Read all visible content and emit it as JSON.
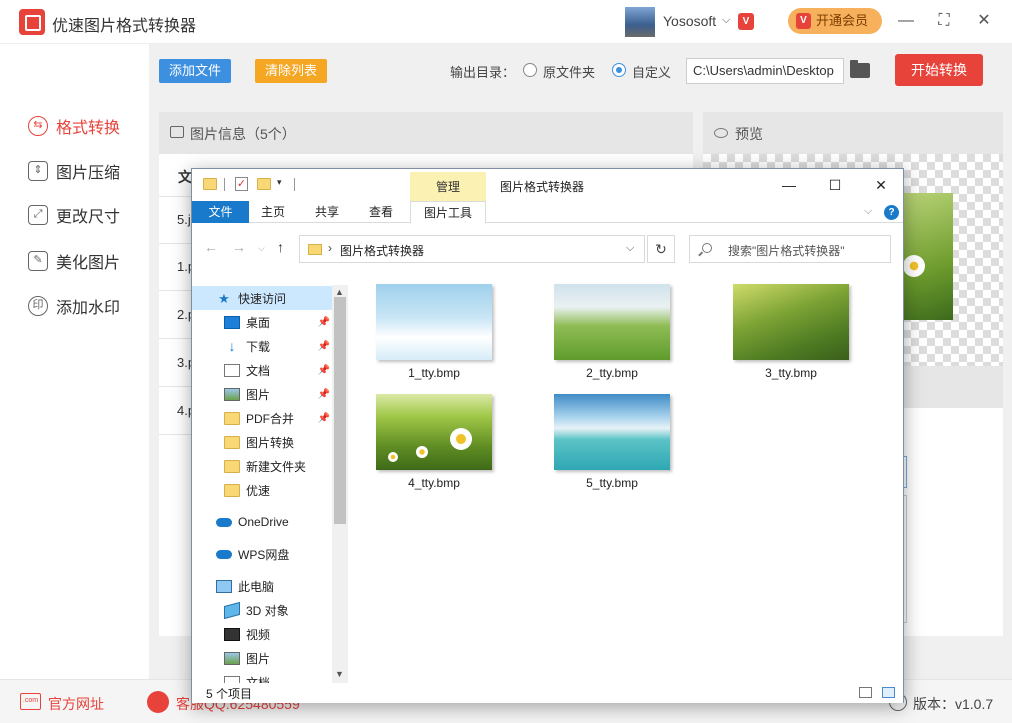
{
  "app": {
    "title": "优速图片格式转换器",
    "user": "Yososoft",
    "vip_button": "开通会员",
    "vip_mark": "V"
  },
  "sidebar": {
    "items": [
      {
        "label": "格式转换",
        "icon": "format-convert-icon",
        "active": true
      },
      {
        "label": "图片压缩",
        "icon": "compress-icon",
        "active": false
      },
      {
        "label": "更改尺寸",
        "icon": "resize-icon",
        "active": false
      },
      {
        "label": "美化图片",
        "icon": "beautify-icon",
        "active": false
      },
      {
        "label": "添加水印",
        "icon": "watermark-icon",
        "active": false
      }
    ]
  },
  "toolbar": {
    "add_file": "添加文件",
    "clear_list": "清除列表",
    "output_label": "输出目录：",
    "radio_original": "原文件夹",
    "radio_custom": "自定义",
    "radio_selected": "custom",
    "path_value": "C:\\Users\\admin\\Desktop",
    "start": "开始转换"
  },
  "image_info": {
    "title": "图片信息（5个）",
    "column_head": "文",
    "rows": [
      "5.j",
      "1.p",
      "2.p",
      "3.p",
      "4.p"
    ]
  },
  "preview": {
    "title": "预览"
  },
  "footer": {
    "website": "官方网址",
    "website_icon_text": ".com",
    "support": "客服QQ:625480559",
    "version": "版本：v1.0.7"
  },
  "explorer": {
    "manage_tab": "管理",
    "window_title": "图片格式转换器",
    "ribbon_tabs": [
      "文件",
      "主页",
      "共享",
      "查看",
      "图片工具"
    ],
    "address": "图片格式转换器",
    "search_placeholder": "搜索\"图片格式转换器\"",
    "nav_items": [
      {
        "label": "快速访问",
        "icon": "star-icon",
        "pinned": false,
        "selected": true,
        "indent": 0
      },
      {
        "label": "桌面",
        "icon": "desktop-icon",
        "pinned": true,
        "selected": false,
        "indent": 1
      },
      {
        "label": "下载",
        "icon": "download-icon",
        "pinned": true,
        "selected": false,
        "indent": 1
      },
      {
        "label": "文档",
        "icon": "document-icon",
        "pinned": true,
        "selected": false,
        "indent": 1
      },
      {
        "label": "图片",
        "icon": "pictures-icon",
        "pinned": true,
        "selected": false,
        "indent": 1
      },
      {
        "label": "PDF合并",
        "icon": "folder-icon",
        "pinned": true,
        "selected": false,
        "indent": 1
      },
      {
        "label": "图片转换",
        "icon": "folder-icon",
        "pinned": false,
        "selected": false,
        "indent": 1
      },
      {
        "label": "新建文件夹",
        "icon": "folder-icon",
        "pinned": false,
        "selected": false,
        "indent": 1
      },
      {
        "label": "优速",
        "icon": "folder-icon",
        "pinned": false,
        "selected": false,
        "indent": 1
      },
      {
        "label": "OneDrive",
        "icon": "onedrive-icon",
        "pinned": false,
        "selected": false,
        "indent": 0
      },
      {
        "label": "WPS网盘",
        "icon": "wps-cloud-icon",
        "pinned": false,
        "selected": false,
        "indent": 0
      },
      {
        "label": "此电脑",
        "icon": "computer-icon",
        "pinned": false,
        "selected": false,
        "indent": 0
      },
      {
        "label": "3D 对象",
        "icon": "3d-objects-icon",
        "pinned": false,
        "selected": false,
        "indent": 1
      },
      {
        "label": "视频",
        "icon": "video-icon",
        "pinned": false,
        "selected": false,
        "indent": 1
      },
      {
        "label": "图片",
        "icon": "pictures-icon",
        "pinned": false,
        "selected": false,
        "indent": 1
      },
      {
        "label": "文档",
        "icon": "document-icon",
        "pinned": false,
        "selected": false,
        "indent": 1
      }
    ],
    "files": [
      {
        "name": "1_tty.bmp",
        "thumb": "sky-clouds"
      },
      {
        "name": "2_tty.bmp",
        "thumb": "green-field"
      },
      {
        "name": "3_tty.bmp",
        "thumb": "yellow-flowers"
      },
      {
        "name": "4_tty.bmp",
        "thumb": "daisies"
      },
      {
        "name": "5_tty.bmp",
        "thumb": "sea-pier"
      }
    ],
    "status": "5 个项目"
  }
}
